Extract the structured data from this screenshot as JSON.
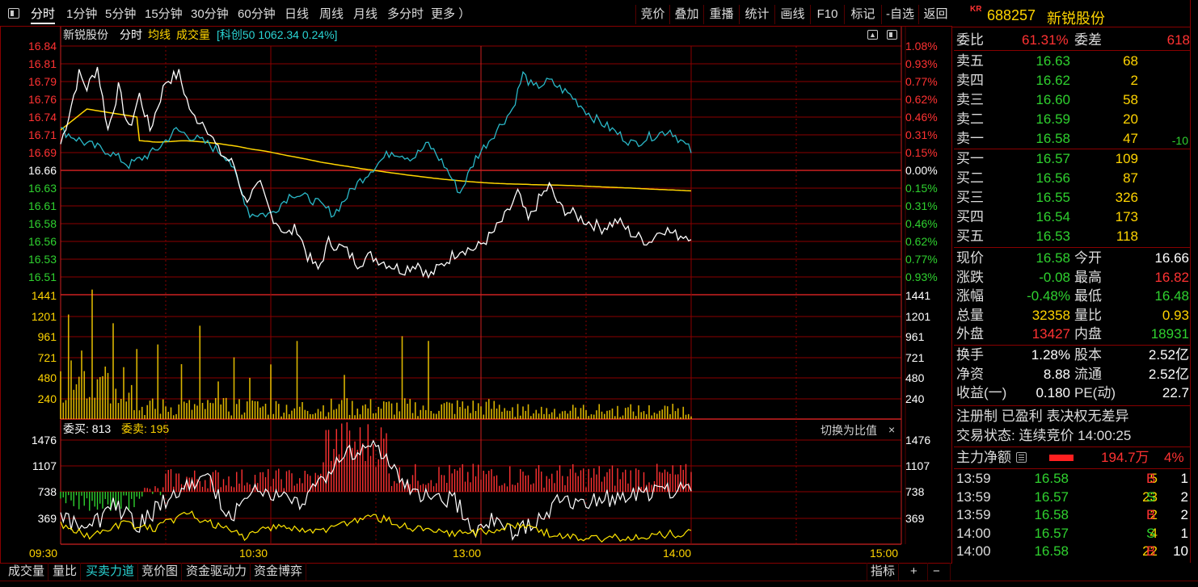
{
  "toolbar": {
    "tabs": [
      "分时",
      "1分钟",
      "5分钟",
      "15分钟",
      "30分钟",
      "60分钟",
      "日线",
      "周线",
      "月线",
      "多分时",
      "更多 ）"
    ],
    "right_buttons": [
      "竞价",
      "叠加",
      "重播",
      "统计",
      "画线",
      "F10",
      "标记",
      "-自选",
      "返回"
    ]
  },
  "stock": {
    "prefix": "KR",
    "code": "688257",
    "name": "新锐股份"
  },
  "chart_header": {
    "name": "新锐股份",
    "mode": "分时",
    "avg_line": "均线",
    "volume": "成交量",
    "index_info": "[科创50 1062.34 0.24%]"
  },
  "price_axis": {
    "left": [
      "16.84",
      "16.81",
      "16.79",
      "16.76",
      "16.74",
      "16.71",
      "16.69",
      "16.66",
      "16.63",
      "16.61",
      "16.58",
      "16.56",
      "16.53",
      "16.51"
    ],
    "right": [
      "1.08%",
      "0.93%",
      "0.77%",
      "0.62%",
      "0.46%",
      "0.31%",
      "0.15%",
      "0.00%",
      "0.15%",
      "0.31%",
      "0.46%",
      "0.62%",
      "0.77%",
      "0.93%"
    ]
  },
  "volume_axis": [
    "1441",
    "1201",
    "961",
    "721",
    "480",
    "240"
  ],
  "order_axis": [
    "1476",
    "1107",
    "738",
    "369"
  ],
  "time_axis": [
    "09:30",
    "10:30",
    "13:00",
    "14:00",
    "15:00"
  ],
  "order_panel": {
    "buy_label": "委买: 813",
    "sell_label": "委卖: 195",
    "switch_label": "切换为比值",
    "close": "×"
  },
  "quote": {
    "weibi_label": "委比",
    "weibi": "61.31%",
    "weicha_label": "委差",
    "weicha": "618",
    "asks": [
      {
        "label": "卖五",
        "price": "16.63",
        "vol": "68",
        "chg": ""
      },
      {
        "label": "卖四",
        "price": "16.62",
        "vol": "2",
        "chg": ""
      },
      {
        "label": "卖三",
        "price": "16.60",
        "vol": "58",
        "chg": ""
      },
      {
        "label": "卖二",
        "price": "16.59",
        "vol": "20",
        "chg": ""
      },
      {
        "label": "卖一",
        "price": "16.58",
        "vol": "47",
        "chg": "-10"
      }
    ],
    "bids": [
      {
        "label": "买一",
        "price": "16.57",
        "vol": "109"
      },
      {
        "label": "买二",
        "price": "16.56",
        "vol": "87"
      },
      {
        "label": "买三",
        "price": "16.55",
        "vol": "326"
      },
      {
        "label": "买四",
        "price": "16.54",
        "vol": "173"
      },
      {
        "label": "买五",
        "price": "16.53",
        "vol": "118"
      }
    ],
    "stats": [
      {
        "l1": "现价",
        "v1": "16.58",
        "l2": "今开",
        "v2": "16.66"
      },
      {
        "l1": "涨跌",
        "v1": "-0.08",
        "l2": "最高",
        "v2": "16.82"
      },
      {
        "l1": "涨幅",
        "v1": "-0.48%",
        "l2": "最低",
        "v2": "16.48"
      },
      {
        "l1": "总量",
        "v1": "32358",
        "l2": "量比",
        "v2": "0.93"
      },
      {
        "l1": "外盘",
        "v1": "13427",
        "l2": "内盘",
        "v2": "18931"
      }
    ],
    "stats2": [
      {
        "l1": "换手",
        "v1": "1.28%",
        "l2": "股本",
        "v2": "2.52亿"
      },
      {
        "l1": "净资",
        "v1": "8.88",
        "l2": "流通",
        "v2": "2.52亿"
      },
      {
        "l1": "收益(一)",
        "v1": "0.180",
        "l2": "PE(动)",
        "v2": "22.7"
      }
    ],
    "notes": "注册制 已盈利 表决权无差异",
    "trade_status": "交易状态: 连续竞价 14:00:25",
    "main_flow_label": "主力净额",
    "main_flow_value": "194.7万",
    "main_flow_pct": "4%",
    "ticks": [
      {
        "time": "13:59",
        "price": "16.58",
        "vol": "5",
        "side": "B",
        "n": "1"
      },
      {
        "time": "13:59",
        "price": "16.57",
        "vol": "23",
        "side": "S",
        "n": "2"
      },
      {
        "time": "13:59",
        "price": "16.58",
        "vol": "2",
        "side": "B",
        "n": "2"
      },
      {
        "time": "14:00",
        "price": "16.57",
        "vol": "4",
        "side": "S",
        "n": "1"
      },
      {
        "time": "14:00",
        "price": "16.58",
        "vol": "22",
        "side": "B",
        "n": "10"
      }
    ]
  },
  "bottom_tabs": [
    "成交量",
    "量比",
    "买卖力道",
    "竞价图",
    "资金驱动力",
    "资金博弈"
  ],
  "bottom_right": [
    "指标",
    "+",
    "−"
  ],
  "colors": {
    "up": "#ff3232",
    "down": "#2fd12f",
    "price_line": "#ffffff",
    "avg_line": "#ffd400",
    "index_line": "#2ab8c8",
    "grid": "#8b0000"
  }
}
